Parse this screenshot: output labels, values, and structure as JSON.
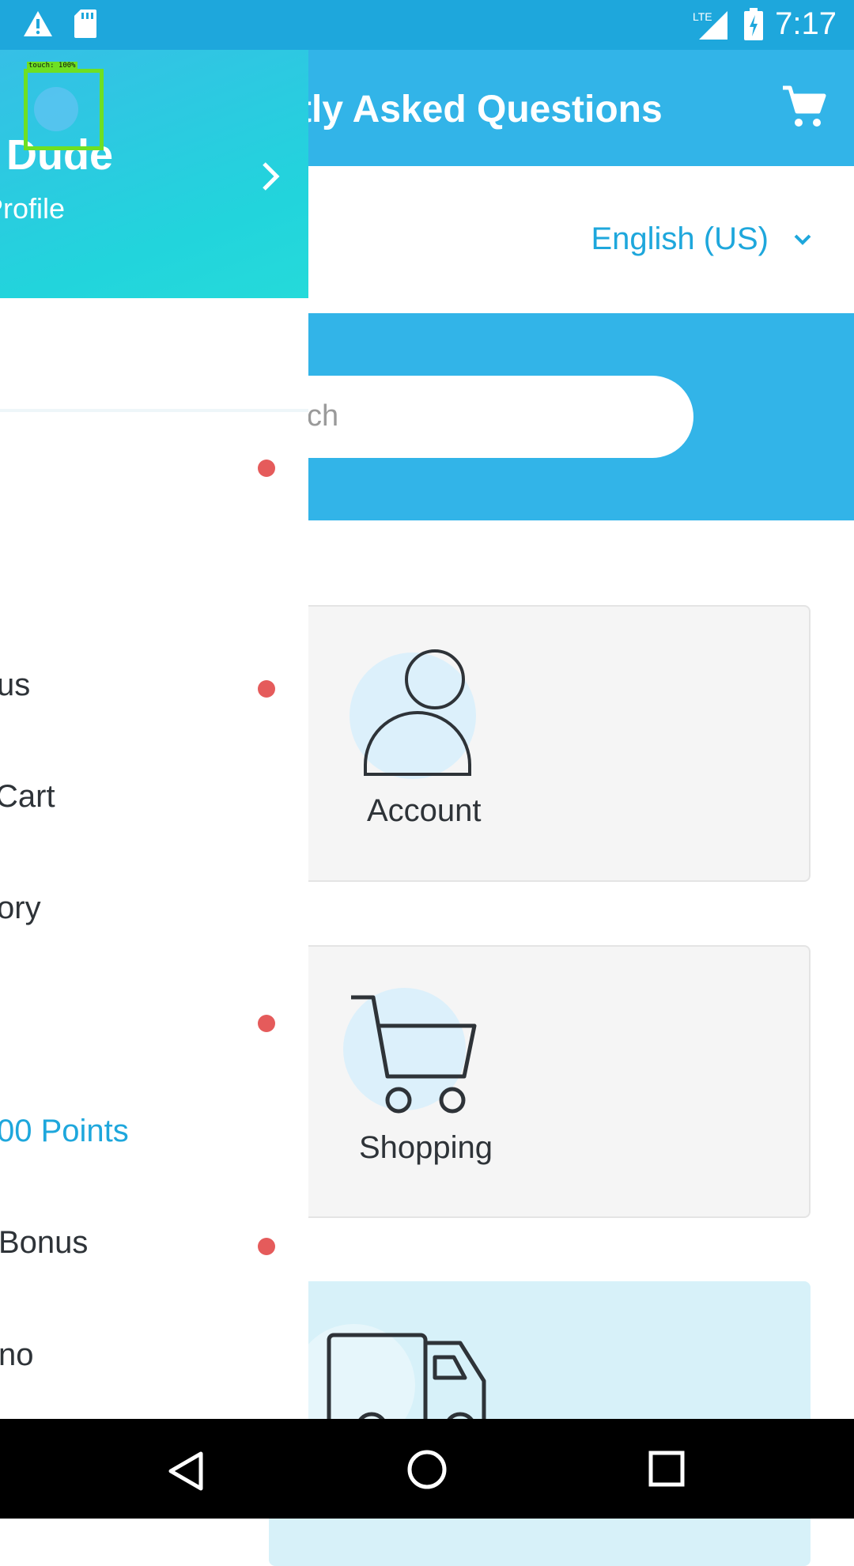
{
  "status_bar": {
    "time": "7:17",
    "network": "LTE",
    "icons": [
      "warning-icon",
      "sd-card-icon",
      "signal-icon",
      "battery-charging-icon"
    ]
  },
  "app_bar": {
    "title": "tly Asked Questions",
    "cart_icon": "cart-icon"
  },
  "language": {
    "selected": "English (US)",
    "icon": "chevron-down-icon"
  },
  "search": {
    "placeholder": "ch"
  },
  "categories": [
    {
      "label": "Account",
      "icon": "person-icon"
    },
    {
      "label": "Shopping",
      "icon": "cart-outline-icon"
    },
    {
      "label": "",
      "icon": "truck-icon"
    }
  ],
  "drawer": {
    "user_name": "o Dude",
    "profile_link": "Profile",
    "chevron_icon": "chevron-right-icon",
    "items": [
      {
        "label": "",
        "dot": true
      },
      {
        "label": "",
        "dot": false
      },
      {
        "label": "us",
        "dot": true
      },
      {
        "label": "Cart",
        "dot": false
      },
      {
        "label": "ory",
        "dot": false
      },
      {
        "label": "",
        "dot": true
      },
      {
        "label": "00 Points",
        "dot": false,
        "accent": true
      },
      {
        "label": " Bonus",
        "dot": true
      },
      {
        "label": "no",
        "dot": false
      }
    ]
  },
  "touch_indicator": {
    "label": "touch: 100%"
  },
  "nav_bar": {
    "icons": [
      "back-icon",
      "home-icon",
      "recents-icon"
    ]
  },
  "colors": {
    "primary": "#32b4e8",
    "status_bar": "#1ea7dc",
    "accent_text": "#1ea7dc",
    "notification_dot": "#e55b5b",
    "drawer_gradient_end": "#22d4dc"
  }
}
